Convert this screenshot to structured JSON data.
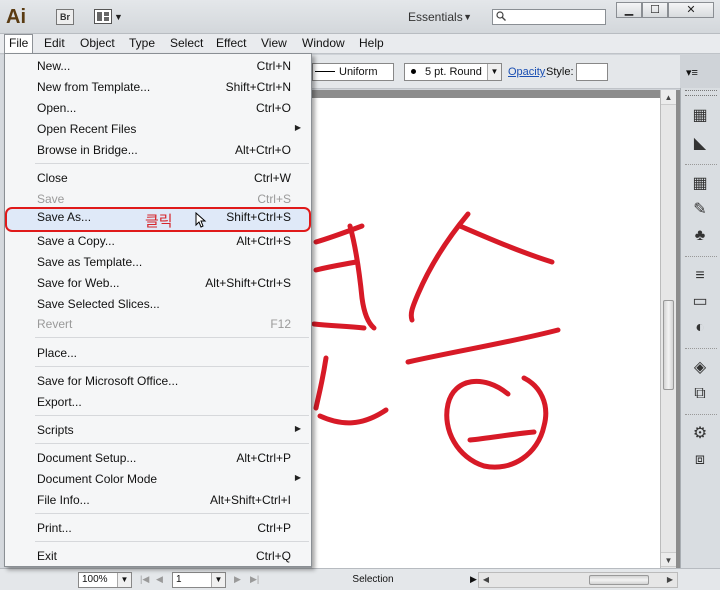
{
  "app": {
    "logo_text": "Ai",
    "bridge_label": "Br",
    "workspace": "Essentials",
    "search_placeholder": ""
  },
  "menubar": {
    "items": [
      "File",
      "Edit",
      "Object",
      "Type",
      "Select",
      "Effect",
      "View",
      "Window",
      "Help"
    ]
  },
  "controlbar": {
    "stroke_profile": "Uniform",
    "brush": "5 pt. Round",
    "opacity_label": "Opacity",
    "style_label": "Style:"
  },
  "file_menu": {
    "items": [
      {
        "label": "New...",
        "shortcut": "Ctrl+N"
      },
      {
        "label": "New from Template...",
        "shortcut": "Shift+Ctrl+N"
      },
      {
        "label": "Open...",
        "shortcut": "Ctrl+O"
      },
      {
        "label": "Open Recent Files",
        "shortcut": ""
      },
      {
        "label": "Browse in Bridge...",
        "shortcut": "Alt+Ctrl+O"
      },
      {
        "label": "Close",
        "shortcut": "Ctrl+W"
      },
      {
        "label": "Save",
        "shortcut": "Ctrl+S"
      },
      {
        "label": "Save As...",
        "shortcut": "Shift+Ctrl+S"
      },
      {
        "label": "Save a Copy...",
        "shortcut": "Alt+Ctrl+S"
      },
      {
        "label": "Save as Template...",
        "shortcut": ""
      },
      {
        "label": "Save for Web...",
        "shortcut": "Alt+Shift+Ctrl+S"
      },
      {
        "label": "Save Selected Slices...",
        "shortcut": ""
      },
      {
        "label": "Revert",
        "shortcut": "F12"
      },
      {
        "label": "Place...",
        "shortcut": ""
      },
      {
        "label": "Save for Microsoft Office...",
        "shortcut": ""
      },
      {
        "label": "Export...",
        "shortcut": ""
      },
      {
        "label": "Scripts",
        "shortcut": ""
      },
      {
        "label": "Document Setup...",
        "shortcut": "Alt+Ctrl+P"
      },
      {
        "label": "Document Color Mode",
        "shortcut": ""
      },
      {
        "label": "File Info...",
        "shortcut": "Alt+Shift+Ctrl+I"
      },
      {
        "label": "Print...",
        "shortcut": "Ctrl+P"
      },
      {
        "label": "Exit",
        "shortcut": "Ctrl+Q"
      }
    ],
    "annotation": "클릭",
    "highlight_color": "#e01a1a"
  },
  "statusbar": {
    "zoom": "100%",
    "page": "1",
    "status": "Selection"
  },
  "colors": {
    "stroke": "#d71a27",
    "accent_link": "#1a4fb3"
  },
  "dock": {
    "icons": [
      "color-guide-icon",
      "color-icon",
      "swatches-icon",
      "brushes-icon",
      "symbols-icon",
      "stroke-icon",
      "gradient-icon",
      "transparency-icon",
      "appearance-icon",
      "layers-icon",
      "artboards-icon",
      "navigator-icon",
      "transform-icon"
    ]
  }
}
